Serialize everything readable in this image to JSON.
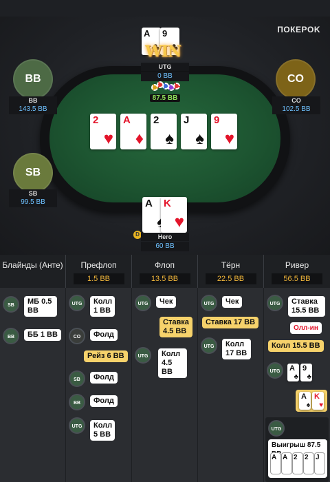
{
  "brand": "ПОКЕРOK",
  "winner_banner": "WIN",
  "pot": "87.5 BB",
  "seats": {
    "bb": {
      "avatar": "BB",
      "name": "BB",
      "stack": "143.5 BB"
    },
    "co": {
      "avatar": "CO",
      "name": "CO",
      "stack": "102.5 BB"
    },
    "sb": {
      "avatar": "SB",
      "name": "SB",
      "stack": "99.5 BB"
    },
    "utg": {
      "name": "UTG",
      "stack": "0 BB",
      "cards": [
        {
          "rank": "A",
          "suit": "♣"
        },
        {
          "rank": "9",
          "suit": "♣"
        }
      ]
    },
    "hero": {
      "name": "Hero",
      "stack": "60 BB",
      "dealer": "D",
      "cards": [
        {
          "rank": "A",
          "suit": "♠"
        },
        {
          "rank": "K",
          "suit": "♥"
        }
      ]
    }
  },
  "board": [
    {
      "rank": "2",
      "suit": "♥"
    },
    {
      "rank": "A",
      "suit": "♦"
    },
    {
      "rank": "2",
      "suit": "♠"
    },
    {
      "rank": "J",
      "suit": "♠"
    },
    {
      "rank": "9",
      "suit": "♥"
    }
  ],
  "streets": [
    {
      "label": "Блайнды (Анте)",
      "amount": ""
    },
    {
      "label": "Префлоп",
      "amount": "1.5 BB"
    },
    {
      "label": "Флоп",
      "amount": "13.5 BB"
    },
    {
      "label": "Тёрн",
      "amount": "22.5 BB"
    },
    {
      "label": "Ривер",
      "amount": "56.5 BB"
    }
  ],
  "actions": {
    "blinds": [
      {
        "pos": "SB",
        "text": "МБ 0.5 BB"
      },
      {
        "pos": "BB",
        "text": "ББ 1 BB"
      }
    ],
    "preflop": [
      {
        "pos": "UTG",
        "text": "Колл 1 BB"
      },
      {
        "pos": "CO",
        "text": "Фолд"
      },
      {
        "pos": "",
        "text": "Рейз 6 BB"
      },
      {
        "pos": "SB",
        "text": "Фолд"
      },
      {
        "pos": "BB",
        "text": "Фолд"
      },
      {
        "pos": "UTG",
        "text": "Колл 5 BB"
      }
    ],
    "flop": [
      {
        "pos": "UTG",
        "text": "Чек"
      },
      {
        "pos": "",
        "text": "Ставка 4.5 BB"
      },
      {
        "pos": "UTG",
        "text": "Колл 4.5 BB"
      }
    ],
    "turn": [
      {
        "pos": "UTG",
        "text": "Чек"
      },
      {
        "pos": "",
        "text": "Ставка 17 BB"
      },
      {
        "pos": "UTG",
        "text": "Колл 17 BB"
      }
    ],
    "river": [
      {
        "pos": "UTG",
        "text": "Ставка 15.5 BB"
      },
      {
        "pos": "",
        "text": "Олл-ин"
      },
      {
        "pos": "",
        "text": "Колл 15.5 BB"
      },
      {
        "pos": "UTG",
        "show": "A♣ 9♣"
      },
      {
        "pos": "",
        "show": "A♠ K♥"
      },
      {
        "pos": "UTG",
        "text": "Выигрыш 87.5 BB"
      }
    ]
  },
  "colors": {
    "accent_yellow": "#f6d26b",
    "stack_blue": "#6ec1ff",
    "pot_green": "#8fe05b",
    "felt": "#1d5531"
  }
}
